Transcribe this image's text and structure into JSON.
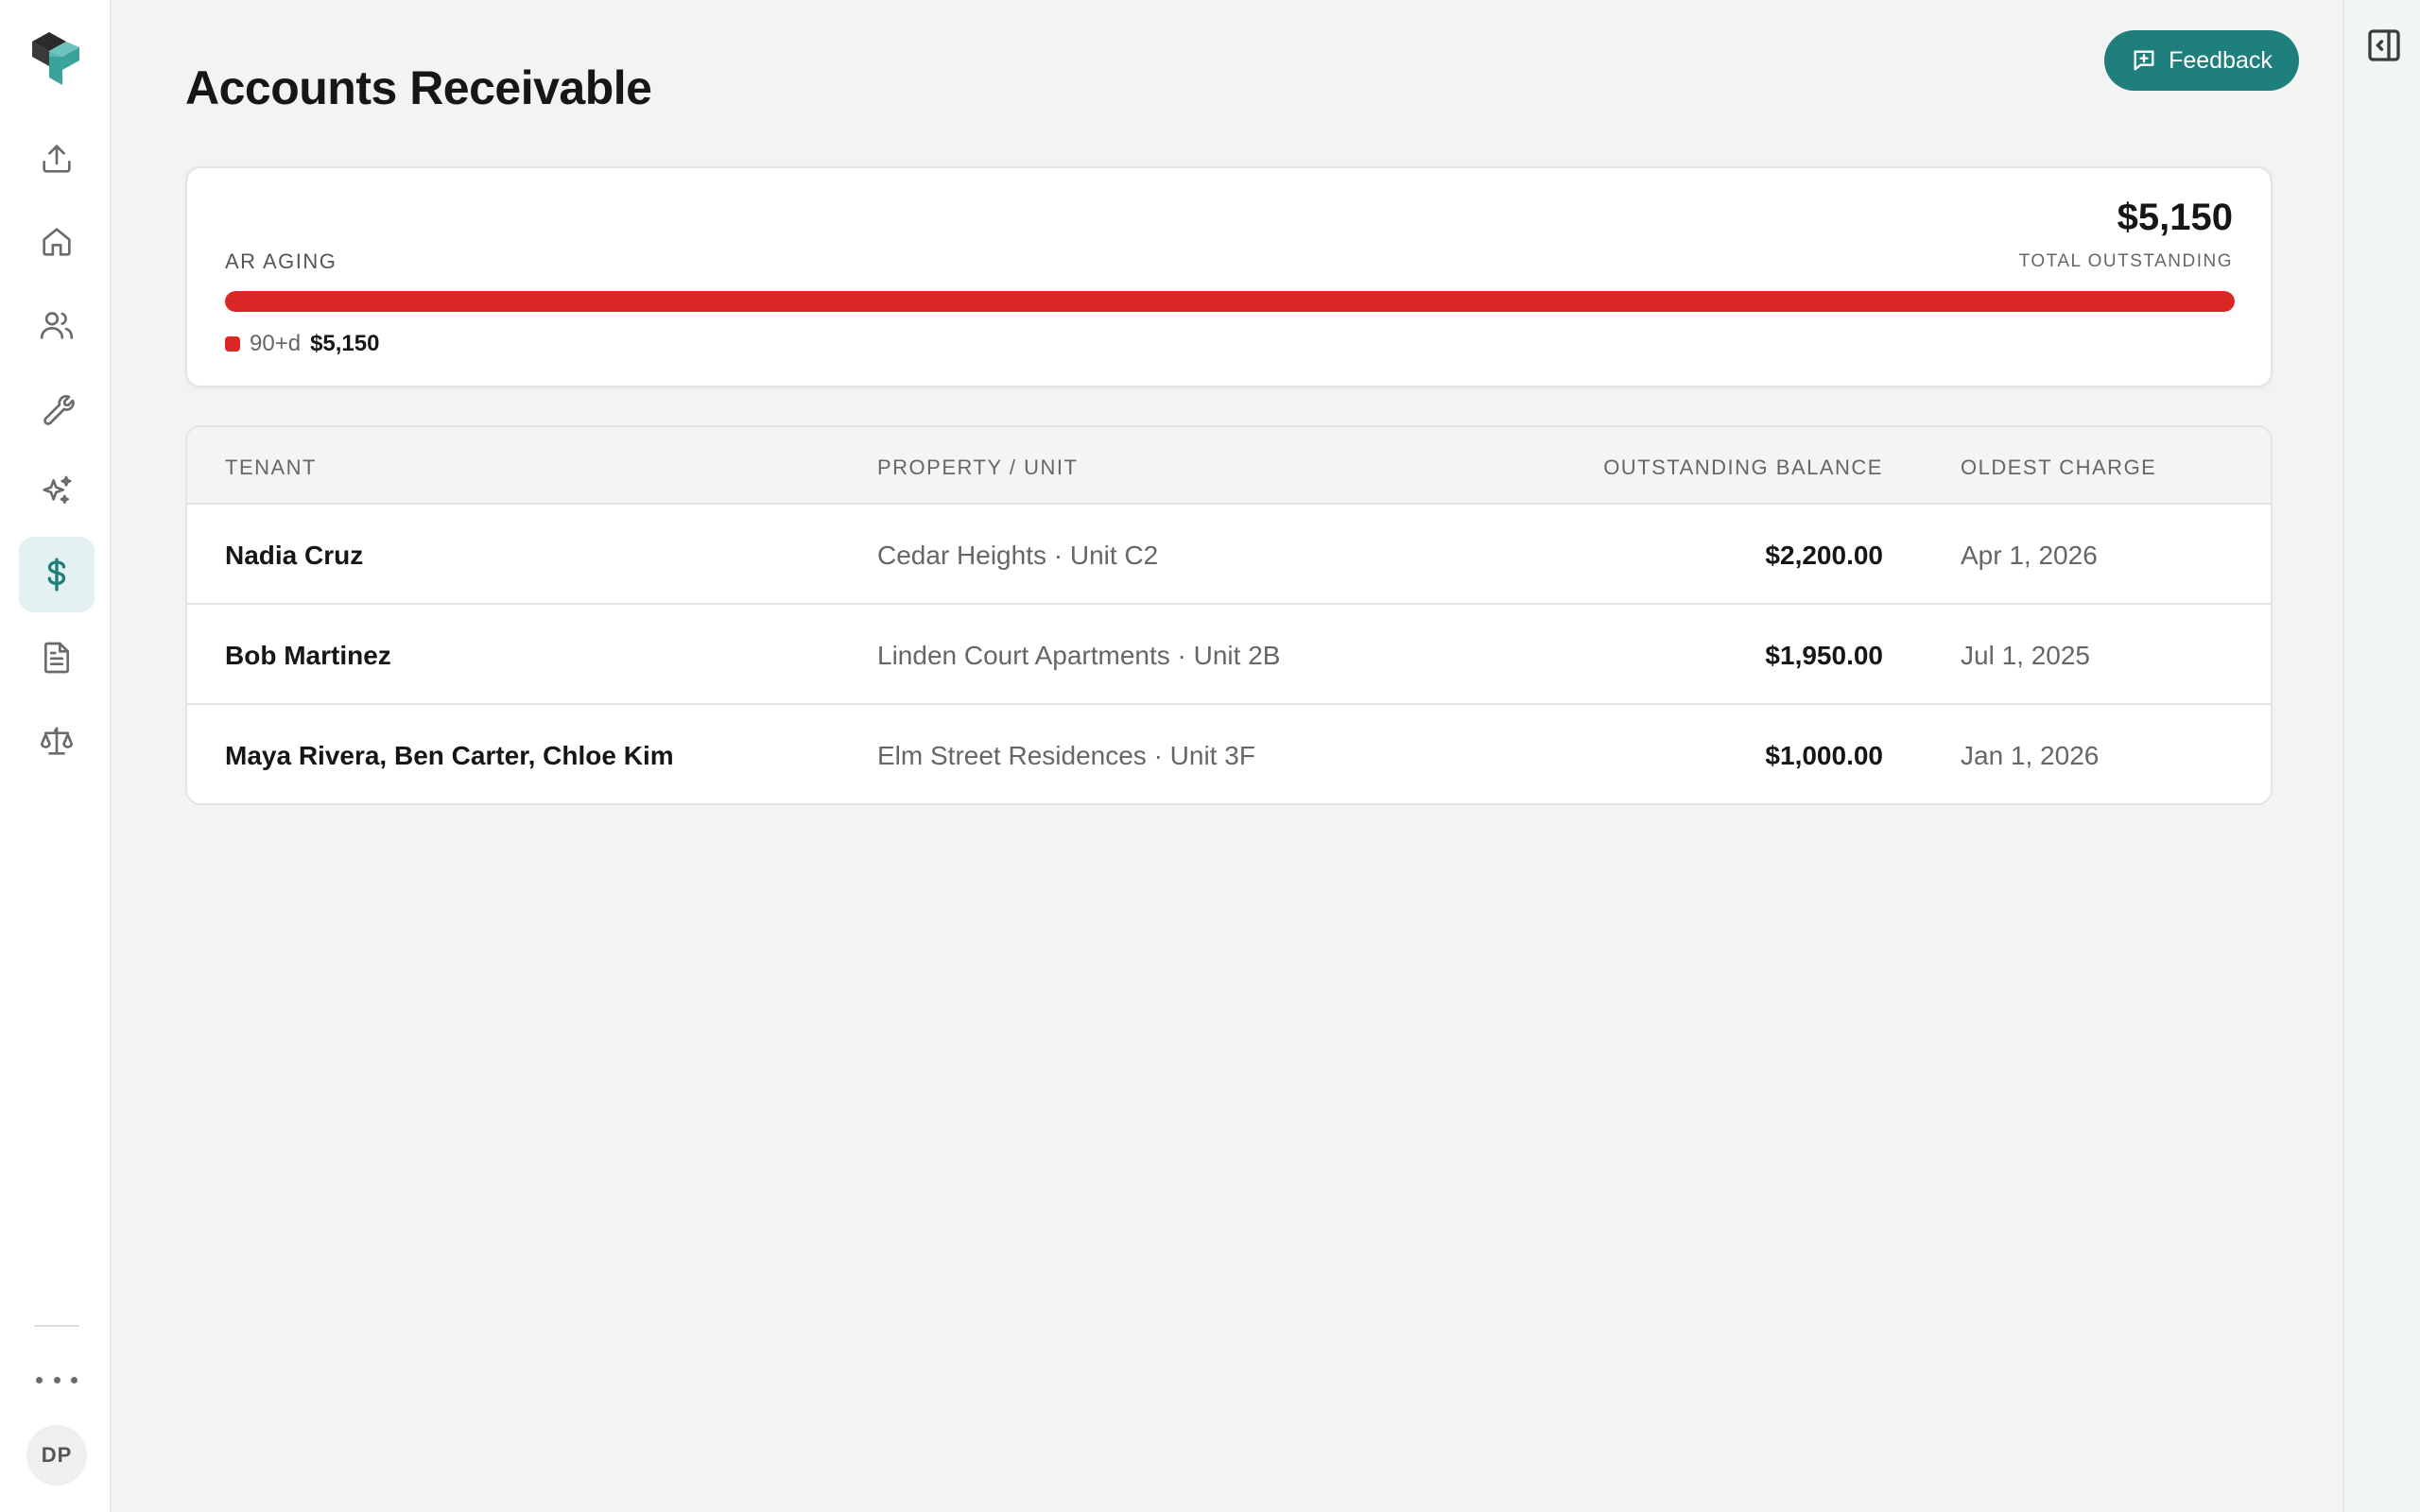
{
  "header": {
    "title": "Accounts Receivable",
    "feedback_label": "Feedback"
  },
  "sidebar": {
    "items": [
      {
        "name": "upload",
        "icon": "upload-icon"
      },
      {
        "name": "home",
        "icon": "home-icon"
      },
      {
        "name": "tenants",
        "icon": "users-icon"
      },
      {
        "name": "maintenance",
        "icon": "wrench-icon"
      },
      {
        "name": "ai",
        "icon": "sparkle-icon"
      },
      {
        "name": "accounts-receivable",
        "icon": "dollar-icon",
        "active": true
      },
      {
        "name": "documents",
        "icon": "document-icon"
      },
      {
        "name": "legal",
        "icon": "scale-icon"
      }
    ],
    "more_icon": "more-horizontal-icon",
    "avatar_initials": "DP"
  },
  "aging": {
    "label": "AR AGING",
    "total_amount": "$5,150",
    "total_label": "TOTAL OUTSTANDING",
    "buckets": [
      {
        "label": "90+d",
        "value": "$5,150",
        "share": 1.0,
        "color": "#dc2626"
      }
    ]
  },
  "table": {
    "columns": [
      "TENANT",
      "PROPERTY / UNIT",
      "OUTSTANDING BALANCE",
      "OLDEST CHARGE"
    ],
    "rows": [
      {
        "tenant": "Nadia Cruz",
        "property": "Cedar Heights · Unit C2",
        "balance": "$2,200.00",
        "oldest": "Apr 1, 2026"
      },
      {
        "tenant": "Bob Martinez",
        "property": "Linden Court Apartments · Unit 2B",
        "balance": "$1,950.00",
        "oldest": "Jul 1, 2025"
      },
      {
        "tenant": "Maya Rivera, Ben Carter, Chloe Kim",
        "property": "Elm Street Residences · Unit 3F",
        "balance": "$1,000.00",
        "oldest": "Jan 1, 2026"
      }
    ]
  },
  "colors": {
    "accent": "#1e7f7c",
    "overdue": "#dc2626",
    "background": "#f3f3f3"
  }
}
